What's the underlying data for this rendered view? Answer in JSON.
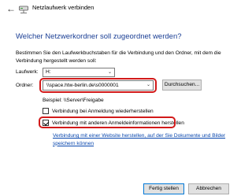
{
  "window": {
    "title": "Netzlaufwerk verbinden"
  },
  "heading": "Welcher Netzwerkordner soll zugeordnet werden?",
  "instructions": "Bestimmen Sie den Laufwerkbuchstaben für die Verbindung und den Ordner, mit dem die Verbindung hergestellt werden soll:",
  "drive": {
    "label": "Laufwerk:",
    "value": "H:"
  },
  "folder": {
    "label": "Ordner:",
    "value": "\\\\space.htw-berlin.de\\s0000001",
    "browse_label": "Durchsuchen..."
  },
  "example": "Beispiel: \\\\Server\\Freigabe",
  "options": {
    "reconnect_label": "Verbindung bei Anmeldung wiederherstellen",
    "reconnect_checked": false,
    "other_credentials_label": "Verbindung mit anderen Anmeldeinformationen herstellen",
    "other_credentials_checked": true
  },
  "link": "Verbindung mit einer Website herstellen, auf der Sie Dokumente und Bilder speichern können",
  "buttons": {
    "finish": "Fertig stellen",
    "cancel": "Abbrechen"
  },
  "colors": {
    "heading": "#1a3e94",
    "link": "#0645ad",
    "highlight": "#d21a1a"
  }
}
